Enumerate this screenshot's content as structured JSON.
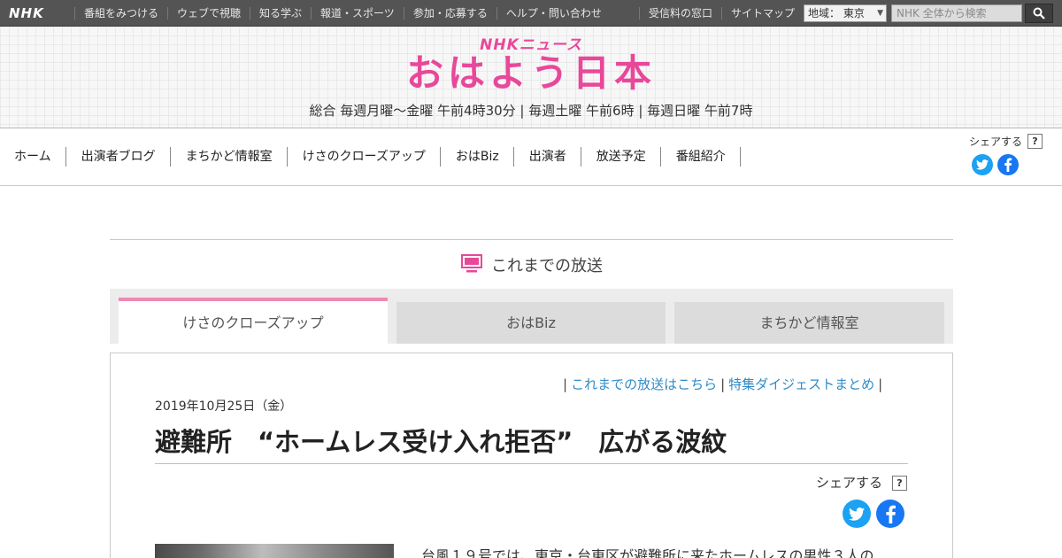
{
  "global_bar": {
    "logo": "NHK",
    "nav": [
      "番組をみつける",
      "ウェブで視聴",
      "知る学ぶ",
      "報道・スポーツ",
      "参加・応募する",
      "ヘルプ・問い合わせ"
    ],
    "right_nav": [
      "受信料の窓口",
      "サイトマップ"
    ],
    "region_label": "地域： 東京",
    "search_placeholder": "NHK 全体から検索",
    "search_icon": "search-icon"
  },
  "program": {
    "brand": "NHKニュース",
    "title": "おはよう日本",
    "schedule": "総合 毎週月曜～金曜 午前4時30分 | 毎週土曜 午前6時 | 毎週日曜 午前7時"
  },
  "program_nav": {
    "items": [
      "ホーム",
      "出演者ブログ",
      "まちかど情報室",
      "けさのクローズアップ",
      "おはBiz",
      "出演者",
      "放送予定",
      "番組紹介"
    ],
    "share_label": "シェアする",
    "help_mark": "?"
  },
  "section": {
    "icon": "tv-icon",
    "heading": "これまでの放送"
  },
  "tabs": [
    {
      "label": "けさのクローズアップ",
      "active": true
    },
    {
      "label": "おはBiz",
      "active": false
    },
    {
      "label": "まちかど情報室",
      "active": false
    }
  ],
  "article": {
    "links": [
      "これまでの放送はこちら",
      "特集ダイジェストまとめ"
    ],
    "link_separator": "|",
    "date": "2019年10月25日（金）",
    "title": "避難所　“ホームレス受け入れ拒否”　広がる波紋",
    "share_label": "シェアする",
    "help_mark": "?",
    "body_start": "台風１９号では、東京・台東区が避難所に来たホームレスの男性３人の"
  },
  "colors": {
    "accent_pink": "#e8489a",
    "tab_active_border": "#f088b4",
    "link_blue": "#2f8bc7",
    "twitter_blue": "#1da1f2",
    "facebook_blue": "#1877f2",
    "global_bar_bg": "#545454"
  }
}
